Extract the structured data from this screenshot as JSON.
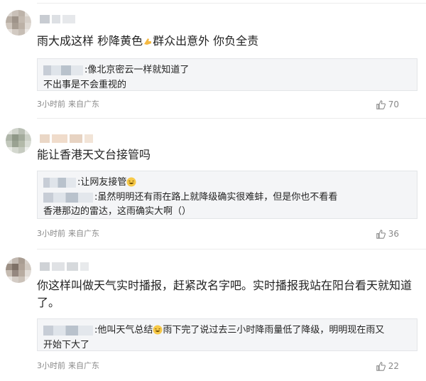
{
  "comments": [
    {
      "text": "雨大成这样 秒降黄色",
      "text_after_emoji": "群众出意外 你负全责",
      "quote_lines": [
        ":像北京密云一样就知道了",
        "不出事是不会重视的"
      ],
      "time": "3小时前",
      "location": "来自广东",
      "likes": "70"
    },
    {
      "text": "能让香港天文台接管吗",
      "quote_lines": [
        ":让网友接管",
        ":虽然明明还有雨在路上就降级确实很难蚌，但是你也不看看",
        "香港那边的雷达，这雨确实大啊（）"
      ],
      "time": "3小时前",
      "location": "来自广东",
      "likes": "36"
    },
    {
      "text": "你这样叫做天气实时播报，赶紧改名字吧。实时播报我站在阳台看天就知道",
      "text_line2": "了。",
      "quote_lines": [
        ":他叫天气总结",
        "雨下完了说过去三小时降雨量低了降级，明明现在雨又",
        "开始下大了"
      ],
      "time": "3小时前",
      "location": "来自广东",
      "likes": "22"
    }
  ],
  "icons": {
    "like": "thumbs-up-icon",
    "emoji_laugh": "laughing-face-icon",
    "emoji_point": "pointing-hand-icon"
  },
  "colors": {
    "meta_gray": "#888888",
    "quote_bg": "#f4f5f7"
  }
}
